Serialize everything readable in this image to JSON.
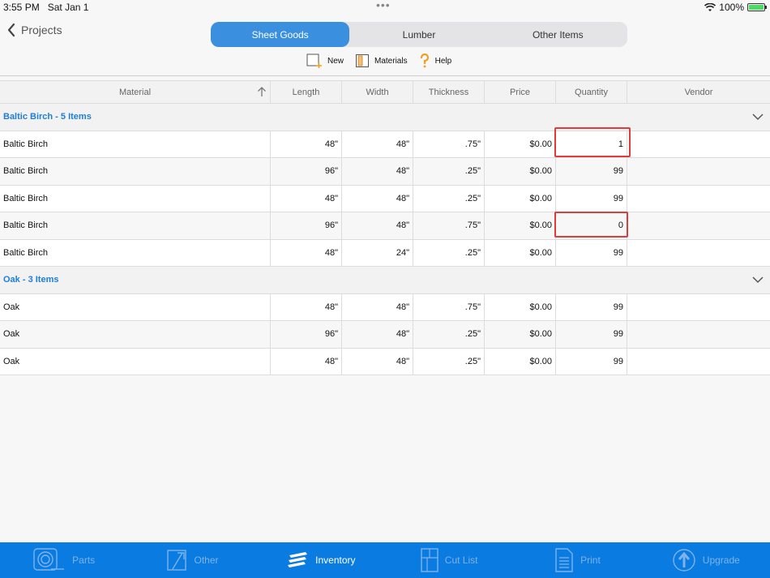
{
  "status_bar": {
    "time": "3:55 PM",
    "date": "Sat Jan 1",
    "battery": "100%"
  },
  "nav": {
    "back_label": "Projects"
  },
  "segments": [
    {
      "label": "Sheet Goods",
      "active": true
    },
    {
      "label": "Lumber",
      "active": false
    },
    {
      "label": "Other Items",
      "active": false
    }
  ],
  "toolbar": {
    "new_label": "New",
    "materials_label": "Materials",
    "help_label": "Help"
  },
  "table": {
    "headers": [
      "Material",
      "Length",
      "Width",
      "Thickness",
      "Price",
      "Quantity",
      "Vendor"
    ],
    "groups": [
      {
        "title": "Baltic Birch - 5 Items",
        "rows": [
          {
            "material": "Baltic Birch",
            "length": "48\"",
            "width": "48\"",
            "thickness": ".75\"",
            "price": "$0.00",
            "quantity": "1",
            "vendor": ""
          },
          {
            "material": "Baltic Birch",
            "length": "96\"",
            "width": "48\"",
            "thickness": ".25\"",
            "price": "$0.00",
            "quantity": "99",
            "vendor": ""
          },
          {
            "material": "Baltic Birch",
            "length": "48\"",
            "width": "48\"",
            "thickness": ".25\"",
            "price": "$0.00",
            "quantity": "99",
            "vendor": ""
          },
          {
            "material": "Baltic Birch",
            "length": "96\"",
            "width": "48\"",
            "thickness": ".75\"",
            "price": "$0.00",
            "quantity": "0",
            "vendor": ""
          },
          {
            "material": "Baltic Birch",
            "length": "48\"",
            "width": "24\"",
            "thickness": ".25\"",
            "price": "$0.00",
            "quantity": "99",
            "vendor": ""
          }
        ]
      },
      {
        "title": "Oak - 3 Items",
        "rows": [
          {
            "material": "Oak",
            "length": "48\"",
            "width": "48\"",
            "thickness": ".75\"",
            "price": "$0.00",
            "quantity": "99",
            "vendor": ""
          },
          {
            "material": "Oak",
            "length": "96\"",
            "width": "48\"",
            "thickness": ".25\"",
            "price": "$0.00",
            "quantity": "99",
            "vendor": ""
          },
          {
            "material": "Oak",
            "length": "48\"",
            "width": "48\"",
            "thickness": ".25\"",
            "price": "$0.00",
            "quantity": "99",
            "vendor": ""
          }
        ]
      }
    ]
  },
  "tabbar": [
    {
      "label": "Parts",
      "icon": "tape-measure-icon",
      "active": false
    },
    {
      "label": "Other",
      "icon": "other-icon",
      "active": false
    },
    {
      "label": "Inventory",
      "icon": "inventory-stack-icon",
      "active": true
    },
    {
      "label": "Cut List",
      "icon": "cut-list-icon",
      "active": false
    },
    {
      "label": "Print",
      "icon": "print-document-icon",
      "active": false
    },
    {
      "label": "Upgrade",
      "icon": "upgrade-arrow-icon",
      "active": false
    }
  ],
  "colors": {
    "accent": "#3a8fdf",
    "tabbar": "#0a7be0",
    "group_title": "#1e7ed8",
    "highlight": "#e03c3c"
  }
}
